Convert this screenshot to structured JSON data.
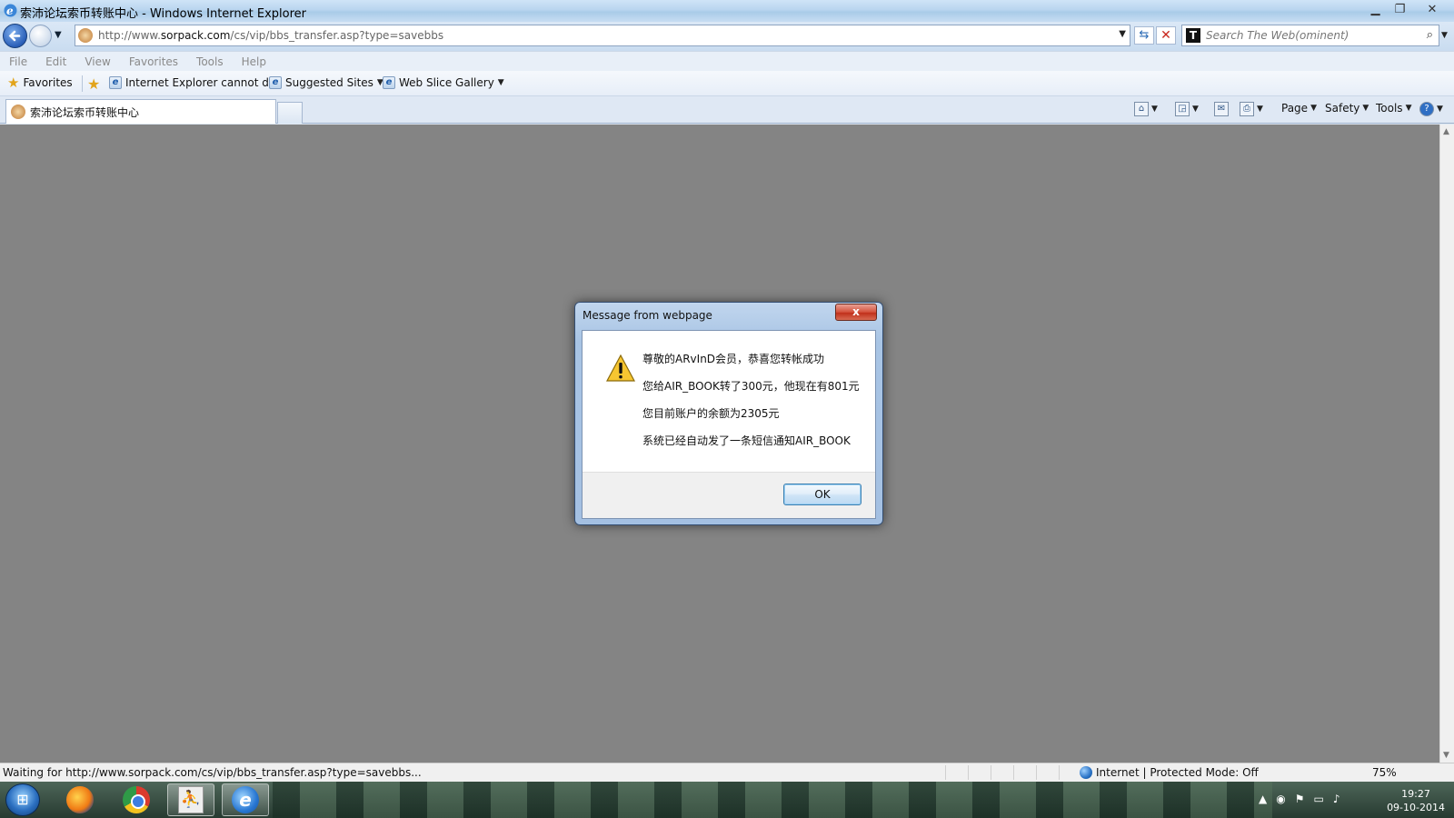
{
  "window": {
    "title": "索沛论坛索币转账中心 - Windows Internet Explorer"
  },
  "address_bar": {
    "url_prefix": "http://www.",
    "url_domain": "sorpack.com",
    "url_rest": "/cs/vip/bbs_transfer.asp?type=savebbs",
    "search_placeholder": "Search The Web(ominent)"
  },
  "menu": [
    "File",
    "Edit",
    "View",
    "Favorites",
    "Tools",
    "Help"
  ],
  "favorites_bar": {
    "favorites_label": "Favorites",
    "items": [
      {
        "label": "Internet Explorer cannot d..."
      },
      {
        "label": "Suggested Sites"
      },
      {
        "label": "Web Slice Gallery"
      }
    ]
  },
  "tabs": [
    {
      "label": "索沛论坛索币转账中心"
    }
  ],
  "command_bar": {
    "page": "Page",
    "safety": "Safety",
    "tools": "Tools"
  },
  "dialog": {
    "title": "Message from webpage",
    "lines": [
      "尊敬的ARvInD会员，恭喜您转帐成功",
      "您给AIR_BOOK转了300元，他现在有801元",
      "您目前账户的余额为2305元",
      "系统已经自动发了一条短信通知AIR_BOOK"
    ],
    "ok_label": "OK",
    "close_label": "x"
  },
  "status_bar": {
    "text": "Waiting for http://www.sorpack.com/cs/vip/bbs_transfer.asp?type=savebbs...",
    "zone": "Internet | Protected Mode: Off",
    "zoom": "75%"
  },
  "taskbar": {
    "time": "19:27",
    "date": "09-10-2014"
  },
  "colors": {
    "content_bg": "#848484",
    "accent": "#2a5fb8"
  }
}
